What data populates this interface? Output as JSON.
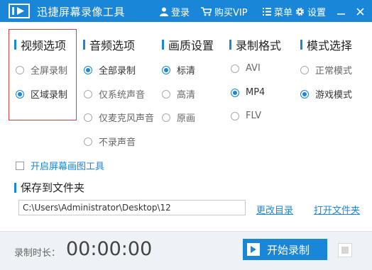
{
  "titlebar": {
    "title": "迅捷屏幕录像工具",
    "login": "登录",
    "buy_vip": "购买VIP",
    "menu": "菜单",
    "settings": "设置"
  },
  "video_options": {
    "header": "视频选项",
    "options": [
      {
        "label": "全屏录制",
        "selected": false
      },
      {
        "label": "区域录制",
        "selected": true
      }
    ]
  },
  "audio_options": {
    "header": "音频选项",
    "options": [
      {
        "label": "全部录制",
        "selected": true
      },
      {
        "label": "仅系统声音",
        "selected": false
      },
      {
        "label": "仅麦克风声音",
        "selected": false
      },
      {
        "label": "不录声音",
        "selected": false
      }
    ]
  },
  "quality": {
    "header": "画质设置",
    "options": [
      {
        "label": "标清",
        "selected": true
      },
      {
        "label": "高清",
        "selected": false
      },
      {
        "label": "原画",
        "selected": false
      }
    ]
  },
  "format": {
    "header": "录制格式",
    "options": [
      {
        "label": "AVI",
        "selected": false
      },
      {
        "label": "MP4",
        "selected": true
      },
      {
        "label": "FLV",
        "selected": false
      }
    ]
  },
  "mode": {
    "header": "模式选择",
    "options": [
      {
        "label": "正常模式",
        "selected": false
      },
      {
        "label": "游戏模式",
        "selected": true
      }
    ]
  },
  "paint_tool": {
    "label": "开启屏幕画图工具",
    "checked": false
  },
  "save": {
    "header": "保存到文件夹",
    "path": "C:\\Users\\Administrator\\Desktop\\12",
    "change_dir": "更改目录",
    "open_folder": "打开文件夹"
  },
  "status": {
    "duration_label": "录制时长：",
    "timer": "00:00:00",
    "start_label": "开始录制"
  },
  "colors": {
    "accent": "#1a86d8",
    "highlight_border": "#e23b3b"
  }
}
